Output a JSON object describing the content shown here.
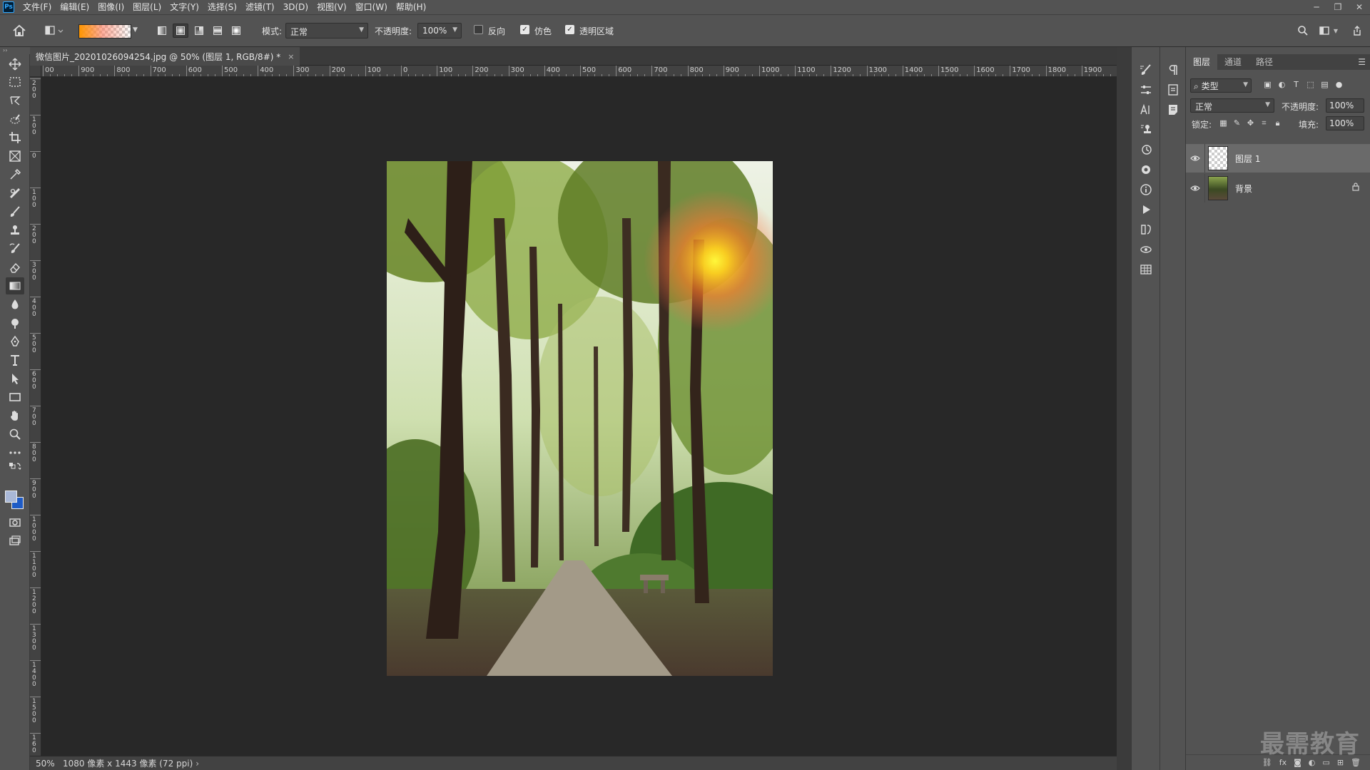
{
  "app": {
    "logo": "Ps",
    "menu": [
      "文件(F)",
      "编辑(E)",
      "图像(I)",
      "图层(L)",
      "文字(Y)",
      "选择(S)",
      "滤镜(T)",
      "3D(D)",
      "视图(V)",
      "窗口(W)",
      "帮助(H)"
    ],
    "window_controls": [
      "minimize-icon",
      "restore-icon",
      "close-icon"
    ]
  },
  "options": {
    "mode_label": "模式:",
    "mode_value": "正常",
    "opacity_label": "不透明度:",
    "opacity_value": "100%",
    "reverse_label": "反向",
    "reverse_checked": false,
    "dither_label": "仿色",
    "dither_checked": true,
    "transparency_label": "透明区域",
    "transparency_checked": true,
    "gradient_types": [
      "linear",
      "radial",
      "angle",
      "reflected",
      "diamond"
    ],
    "active_gradient_type": "radial"
  },
  "document": {
    "tab_title": "微信图片_20201026094254.jpg @ 50% (图层 1, RGB/8#) *",
    "close": "×"
  },
  "rulers": {
    "top": [
      "00",
      "900",
      "800",
      "700",
      "600",
      "500",
      "400",
      "300",
      "200",
      "100",
      "0",
      "100",
      "200",
      "300",
      "400",
      "500",
      "600",
      "700",
      "800",
      "900",
      "1000",
      "1100",
      "1200",
      "1300",
      "1400",
      "1500",
      "1600",
      "1700",
      "1800",
      "1900",
      "200"
    ],
    "left": [
      "2\n0\n0",
      "1\n0\n0",
      "0",
      "1\n0\n0",
      "2\n0\n0",
      "3\n0\n0",
      "4\n0\n0",
      "5\n0\n0",
      "6\n0\n0",
      "7\n0\n0",
      "8\n0\n0",
      "9\n0\n0",
      "1\n0\n0\n0",
      "1\n1\n0\n0",
      "1\n2\n0\n0",
      "1\n3\n0\n0",
      "1\n4\n0\n0",
      "1\n5\n0\n0",
      "1\n6\n0"
    ]
  },
  "status": {
    "zoom": "50%",
    "info": "1080 像素 x 1443 像素 (72 ppi)",
    "arrow": "›"
  },
  "layers_panel": {
    "tabs": [
      "图层",
      "通道",
      "路径"
    ],
    "active_tab": "图层",
    "filter": "类型",
    "blend_mode": "正常",
    "opacity_label": "不透明度:",
    "opacity_value": "100%",
    "lock_label": "锁定:",
    "fill_label": "填充:",
    "fill_value": "100%",
    "layers": [
      {
        "name": "图层 1",
        "selected": true,
        "visible": true,
        "locked": false
      },
      {
        "name": "背景",
        "selected": false,
        "visible": true,
        "locked": true
      }
    ]
  },
  "watermark": "最需教育",
  "colors": {
    "foreground": "#a9b8d7",
    "background": "#1e5bc6",
    "gradient_start": "#ff9600"
  }
}
